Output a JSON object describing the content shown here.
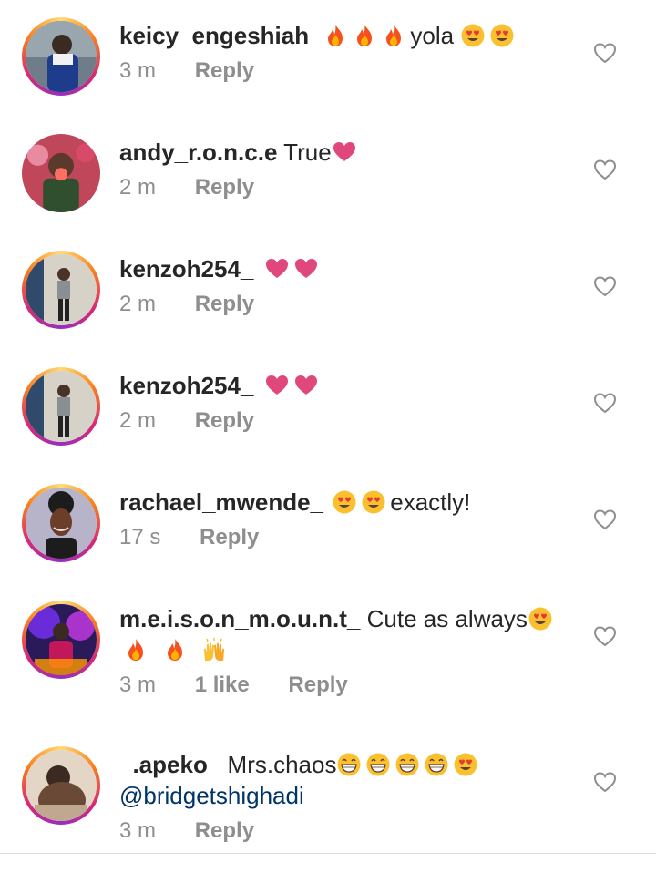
{
  "comments": [
    {
      "username": "keicy_engeshiah",
      "text_pre_emoji": [
        "fire",
        "fire",
        "fire"
      ],
      "text": "yola",
      "text_post_emoji": [
        "heart-eyes",
        "heart-eyes"
      ],
      "time": "3 m",
      "reply": "Reply"
    },
    {
      "username": "andy_r.o.n.c.e",
      "text": "True",
      "text_post_emoji": [
        "pink-heart"
      ],
      "time": "2 m",
      "reply": "Reply"
    },
    {
      "username": "kenzoh254_",
      "text_post_emoji": [
        "pink-heart",
        "pink-heart"
      ],
      "time": "2 m",
      "reply": "Reply"
    },
    {
      "username": "kenzoh254_",
      "text_post_emoji": [
        "pink-heart",
        "pink-heart"
      ],
      "time": "2 m",
      "reply": "Reply"
    },
    {
      "username": "rachael_mwende_",
      "text_pre_emoji": [
        "heart-eyes",
        "heart-eyes"
      ],
      "text": "exactly!",
      "time": "17 s",
      "reply": "Reply"
    },
    {
      "username": "m.e.i.s.o.n_m.o.u.n.t_",
      "text": "Cute as always",
      "text_post_emoji": [
        "heart-eyes"
      ],
      "line2_emoji": [
        "fire",
        "fire",
        "raising-hands"
      ],
      "time": "3 m",
      "likes": "1 like",
      "reply": "Reply"
    },
    {
      "username": "_.apeko_",
      "text": "Mrs.chaos",
      "text_post_emoji": [
        "grinning",
        "grinning",
        "grinning",
        "grinning",
        "heart-eyes"
      ],
      "mention": "@bridgetshighadi",
      "time": "3 m",
      "reply": "Reply"
    }
  ],
  "icons": {
    "like": "heart-outline-icon"
  },
  "colors": {
    "username": "#262626",
    "meta": "#8e8e8e",
    "mention": "#003569",
    "ring_start": "#feda75",
    "ring_mid": "#d62976",
    "ring_end": "#962fbf"
  }
}
